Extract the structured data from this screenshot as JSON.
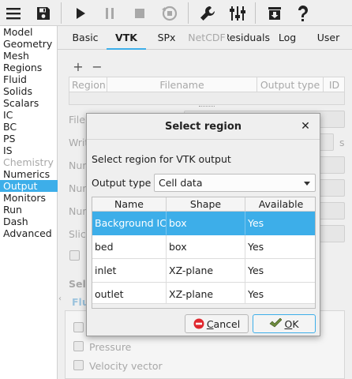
{
  "toolbar": {
    "buttons": [
      "menu-icon",
      "save-icon",
      "play-icon",
      "pause-icon",
      "stop-icon",
      "reset-icon",
      "wrench-icon",
      "sliders-icon",
      "download-icon",
      "help-icon"
    ]
  },
  "sidebar": {
    "items": [
      {
        "label": "Model",
        "state": "normal"
      },
      {
        "label": "Geometry",
        "state": "normal"
      },
      {
        "label": "Mesh",
        "state": "normal"
      },
      {
        "label": "Regions",
        "state": "normal"
      },
      {
        "label": "Fluid",
        "state": "normal"
      },
      {
        "label": "Solids",
        "state": "normal"
      },
      {
        "label": "Scalars",
        "state": "normal"
      },
      {
        "label": "IC",
        "state": "normal"
      },
      {
        "label": "BC",
        "state": "normal"
      },
      {
        "label": "PS",
        "state": "normal"
      },
      {
        "label": "IS",
        "state": "normal"
      },
      {
        "label": "Chemistry",
        "state": "disabled"
      },
      {
        "label": "Numerics",
        "state": "normal"
      },
      {
        "label": "Output",
        "state": "selected"
      },
      {
        "label": "Monitors",
        "state": "normal"
      },
      {
        "label": "Run",
        "state": "normal"
      },
      {
        "label": "Dash",
        "state": "normal"
      },
      {
        "label": "Advanced",
        "state": "normal"
      }
    ]
  },
  "tabs": [
    {
      "label": "Basic",
      "state": "normal"
    },
    {
      "label": "VTK",
      "state": "active"
    },
    {
      "label": "SPx",
      "state": "normal"
    },
    {
      "label": "NetCDF",
      "state": "disabled"
    },
    {
      "label": "Residuals",
      "state": "normal"
    },
    {
      "label": "Log",
      "state": "normal"
    },
    {
      "label": "User",
      "state": "normal"
    }
  ],
  "background": {
    "add_symbol": "+",
    "remove_symbol": "−",
    "table_headers": [
      "Region",
      "Filename",
      "Output type",
      "ID"
    ],
    "labels": [
      "File",
      "Writ",
      "Num",
      "Num",
      "Num",
      "Slic",
      "Sele",
      "Flu"
    ],
    "side_s": "s",
    "checkbox_labels": [
      "Pressure",
      "Velocity vector"
    ]
  },
  "dialog": {
    "title": "Select region",
    "close_symbol": "✕",
    "message": "Select region for VTK output",
    "output_type_label": "Output type",
    "output_type_value": "Cell data",
    "columns": [
      "Name",
      "Shape",
      "Available"
    ],
    "rows": [
      {
        "name": "Background IC",
        "shape": "box",
        "available": "Yes",
        "selected": true
      },
      {
        "name": "bed",
        "shape": "box",
        "available": "Yes",
        "selected": false
      },
      {
        "name": "inlet",
        "shape": "XZ-plane",
        "available": "Yes",
        "selected": false
      },
      {
        "name": "outlet",
        "shape": "XZ-plane",
        "available": "Yes",
        "selected": false
      }
    ],
    "cancel_mnemonic": "C",
    "cancel_rest": "ancel",
    "ok_mnemonic": "O",
    "ok_rest": "K",
    "colors": {
      "selection": "#3daee9",
      "cancel_icon": "#e0282e",
      "ok_icon": "#6e8b3d"
    }
  }
}
